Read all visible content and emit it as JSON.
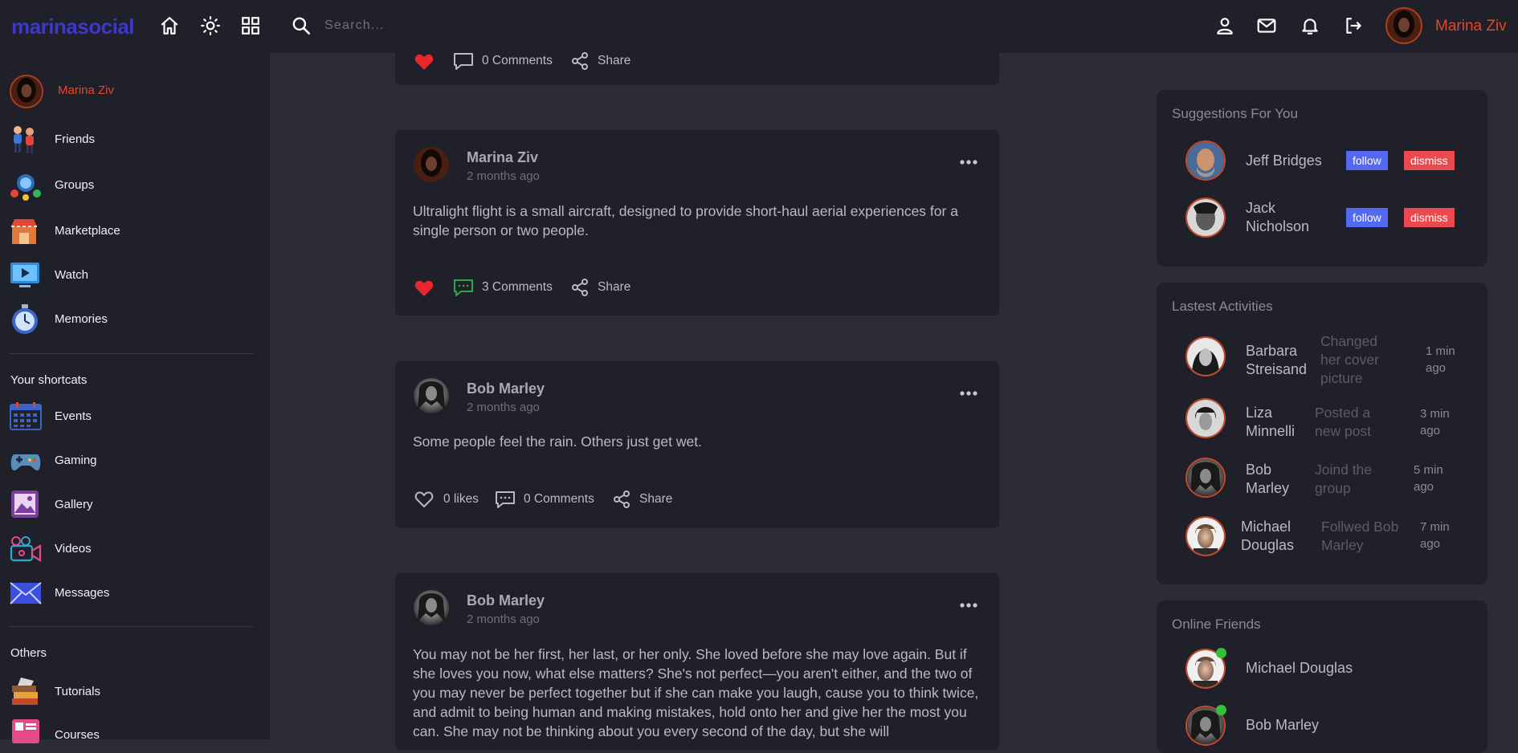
{
  "app": {
    "logo": "marinasocial"
  },
  "search": {
    "placeholder": "Search..."
  },
  "current_user": {
    "name": "Marina Ziv"
  },
  "sidebar": {
    "user_name": "Marina Ziv",
    "items": [
      {
        "label": "Friends",
        "icon": "friends-icon"
      },
      {
        "label": "Groups",
        "icon": "groups-icon"
      },
      {
        "label": "Marketplace",
        "icon": "marketplace-icon"
      },
      {
        "label": "Watch",
        "icon": "watch-icon"
      },
      {
        "label": "Memories",
        "icon": "memories-icon"
      }
    ],
    "shortcuts_heading": "Your shortcats",
    "shortcuts": [
      {
        "label": "Events",
        "icon": "events-icon"
      },
      {
        "label": "Gaming",
        "icon": "gaming-icon"
      },
      {
        "label": "Gallery",
        "icon": "gallery-icon"
      },
      {
        "label": "Videos",
        "icon": "videos-icon"
      },
      {
        "label": "Messages",
        "icon": "messages-icon"
      }
    ],
    "others_heading": "Others",
    "others": [
      {
        "label": "Tutorials",
        "icon": "tutorials-icon"
      },
      {
        "label": "Courses",
        "icon": "courses-icon"
      }
    ]
  },
  "feed": {
    "partial_post": {
      "comments": "0 Comments",
      "share": "Share"
    },
    "posts": [
      {
        "author": "Marina Ziv",
        "time": "2 months ago",
        "text": "Ultralight flight is a small aircraft, designed to provide short-haul aerial experiences for a single person or two people.",
        "liked": true,
        "comments": "3 Comments",
        "share": "Share"
      },
      {
        "author": "Bob Marley",
        "time": "2 months ago",
        "text": "Some people feel the rain. Others just get wet.",
        "liked": false,
        "likes": "0 likes",
        "comments": "0 Comments",
        "share": "Share"
      },
      {
        "author": "Bob Marley",
        "time": "2 months ago",
        "text": "You may not be her first, her last, or her only. She loved before she may love again. But if she loves you now, what else matters? She's not perfect—you aren't either, and the two of you may never be perfect together but if she can make you laugh, cause you to think twice, and admit to being human and making mistakes, hold onto her and give her the most you can. She may not be thinking about you every second of the day, but she will"
      }
    ]
  },
  "suggestions": {
    "title": "Suggestions For You",
    "people": [
      {
        "name": "Jeff Bridges",
        "follow": "follow",
        "dismiss": "dismiss"
      },
      {
        "name": "Jack Nicholson",
        "follow": "follow",
        "dismiss": "dismiss"
      }
    ]
  },
  "activities": {
    "title": "Lastest Activities",
    "items": [
      {
        "name": "Barbara Streisand",
        "action": "Changed her cover picture",
        "time": "1 min ago"
      },
      {
        "name": "Liza Minnelli",
        "action": "Posted a new post",
        "time": "3 min ago"
      },
      {
        "name": "Bob Marley",
        "action": "Joind the group",
        "time": "5 min ago"
      },
      {
        "name": "Michael Douglas",
        "action": "Follwed Bob Marley",
        "time": "7 min ago"
      }
    ]
  },
  "online": {
    "title": "Online Friends",
    "friends": [
      {
        "name": "Michael Douglas"
      },
      {
        "name": "Bob Marley"
      }
    ]
  },
  "colors": {
    "accent": "#e0482a",
    "logo": "#3d38c9",
    "like": "#e8262b",
    "comment_active": "#2aa84a",
    "follow": "#5469f2",
    "dismiss": "#ea4a4f",
    "online": "#34c139"
  }
}
